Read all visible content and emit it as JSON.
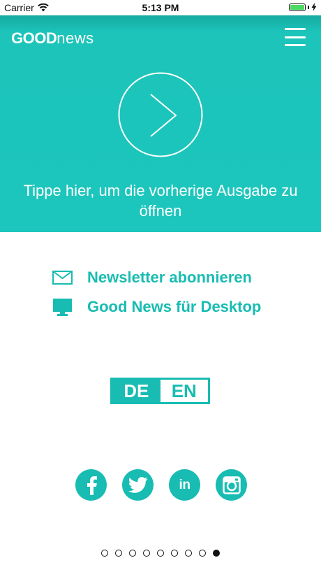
{
  "status_bar": {
    "carrier": "Carrier",
    "time": "5:13 PM",
    "battery_level": 1.0,
    "battery_color": "#4cd964"
  },
  "header": {
    "logo_bold": "GOOD",
    "logo_light": "news",
    "menu_icon": "hamburger-menu-icon"
  },
  "hero": {
    "background_color": "#1dc6bc",
    "play_icon": "chevron-right-circle-icon",
    "caption": "Tippe hier, um die vorherige Ausgabe zu öffnen"
  },
  "links": [
    {
      "icon": "envelope-icon",
      "label": "Newsletter abonnieren"
    },
    {
      "icon": "desktop-monitor-icon",
      "label": "Good News für Desktop"
    }
  ],
  "language_switch": {
    "options": [
      "DE",
      "EN"
    ],
    "selected": "DE"
  },
  "social": [
    {
      "icon": "facebook-icon"
    },
    {
      "icon": "twitter-icon"
    },
    {
      "icon": "linkedin-icon",
      "label": "in"
    },
    {
      "icon": "instagram-icon"
    }
  ],
  "pagination": {
    "count": 9,
    "current": 9
  },
  "colors": {
    "accent": "#18bcb2",
    "text_dark": "#111111"
  }
}
